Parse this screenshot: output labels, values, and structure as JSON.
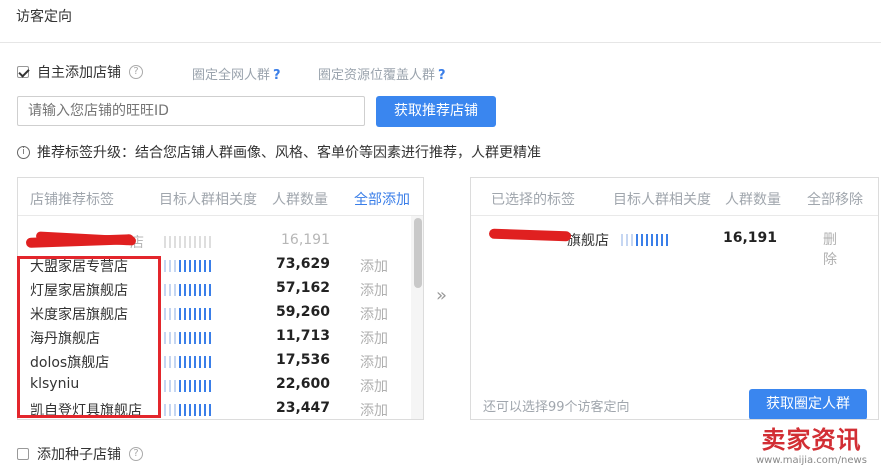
{
  "header": {
    "title": "访客定向"
  },
  "self_add": {
    "checked": true,
    "label": "自主添加店铺"
  },
  "links": [
    {
      "label": "圈定全网人群"
    },
    {
      "label": "圈定资源位覆盖人群"
    }
  ],
  "search": {
    "placeholder": "请输入您店铺的旺旺ID",
    "button": "获取推荐店铺"
  },
  "tip": "推荐标签升级：结合您店铺人群画像、风格、客单价等因素进行推荐，人群更精准",
  "left_panel": {
    "columns": [
      "店铺推荐标签",
      "目标人群相关度",
      "人群数量",
      "全部添加"
    ],
    "rows": [
      {
        "name": "店",
        "relevance": 0.3,
        "count": "16,191",
        "action": "",
        "faded": true
      },
      {
        "name": "大盟家居专营店",
        "relevance": 0.7,
        "count": "73,629",
        "action": "添加"
      },
      {
        "name": "灯屋家居旗舰店",
        "relevance": 0.7,
        "count": "57,162",
        "action": "添加"
      },
      {
        "name": "米度家居旗舰店",
        "relevance": 0.7,
        "count": "59,260",
        "action": "添加"
      },
      {
        "name": "海丹旗舰店",
        "relevance": 0.7,
        "count": "11,713",
        "action": "添加"
      },
      {
        "name": "dolos旗舰店",
        "relevance": 0.7,
        "count": "17,536",
        "action": "添加"
      },
      {
        "name": "klsyniu",
        "relevance": 0.7,
        "count": "22,600",
        "action": "添加"
      },
      {
        "name": "凯自登灯具旗舰店",
        "relevance": 0.7,
        "count": "23,447",
        "action": "添加"
      }
    ]
  },
  "transfer_arrow": "»",
  "right_panel": {
    "columns": [
      "已选择的标签",
      "目标人群相关度",
      "人群数量",
      "全部移除"
    ],
    "rows": [
      {
        "name": "旗舰店",
        "relevance": 0.7,
        "count": "16,191",
        "action": "删除"
      }
    ],
    "footer": "还可以选择99个访客定向",
    "button": "获取圈定人群"
  },
  "seed": {
    "checked": false,
    "label": "添加种子店铺"
  },
  "watermark": {
    "big": "卖家资讯",
    "small": "www.maijia.com/news"
  }
}
